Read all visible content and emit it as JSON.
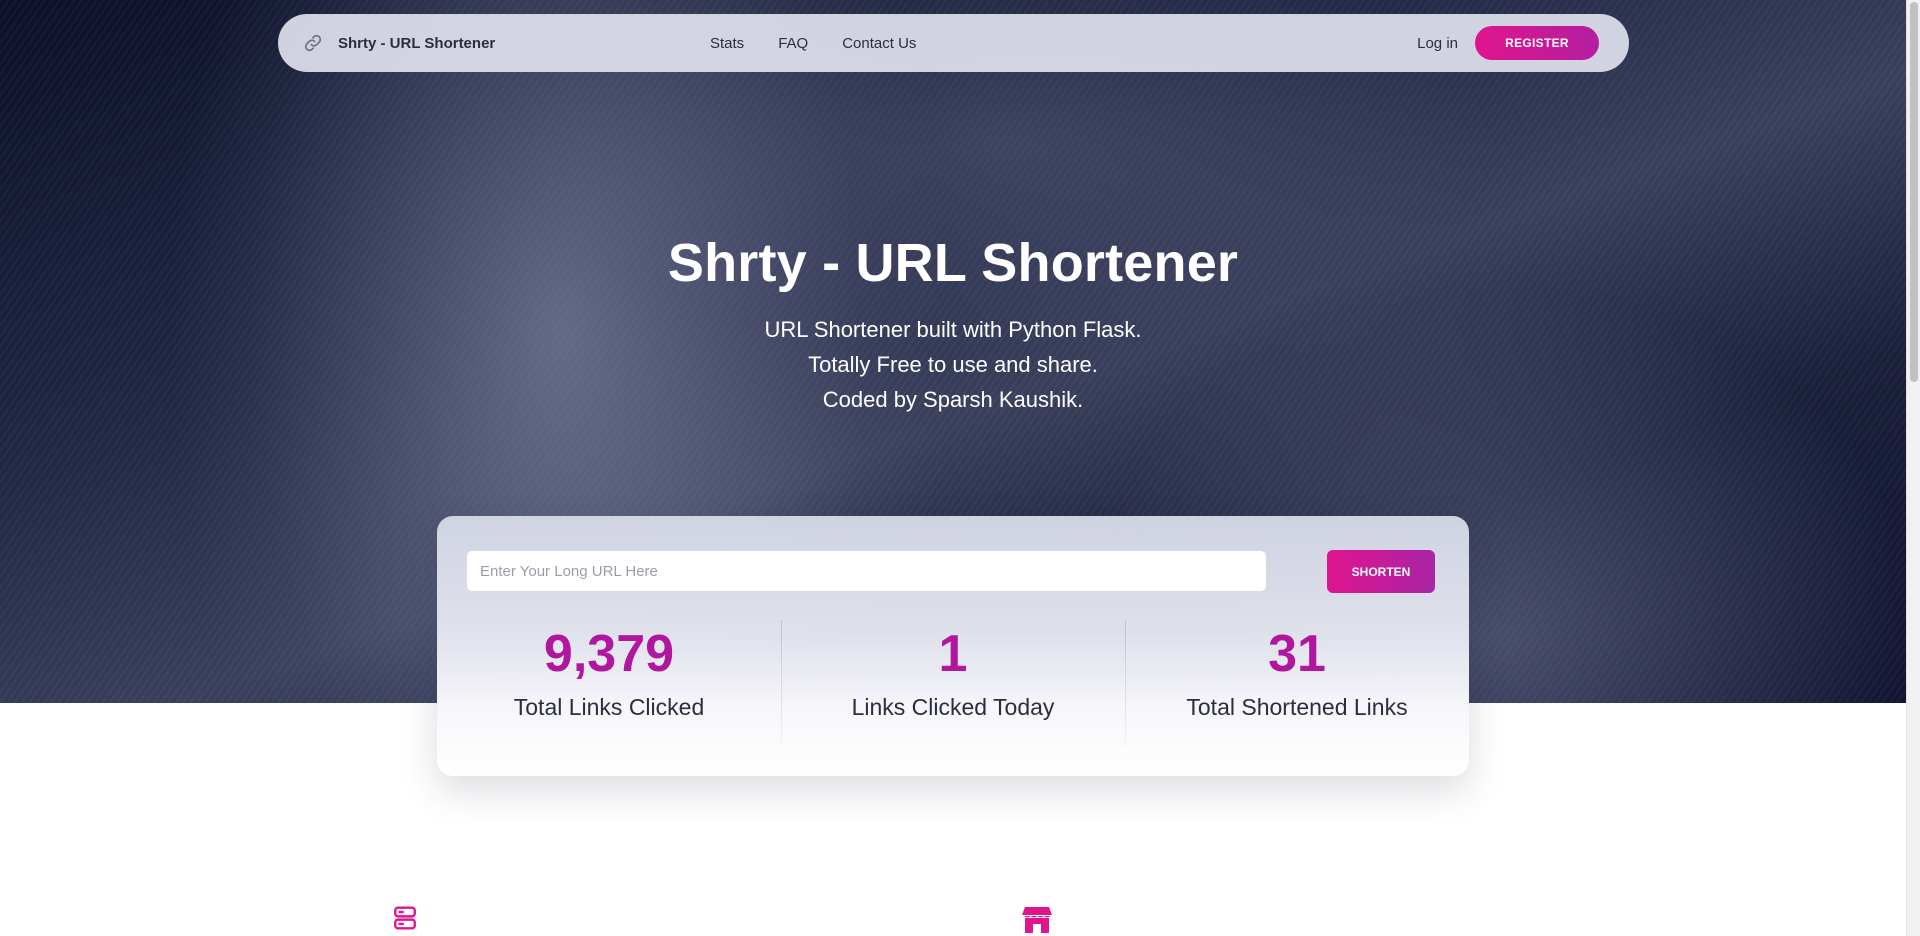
{
  "navbar": {
    "brand": "Shrty - URL Shortener",
    "brand_icon": "link-icon",
    "links": [
      "Stats",
      "FAQ",
      "Contact Us"
    ],
    "login": "Log in",
    "register": "REGISTER"
  },
  "hero": {
    "title": "Shrty - URL Shortener",
    "lines": [
      "URL Shortener built with Python Flask.",
      "Totally Free to use and share.",
      "Coded by Sparsh Kaushik."
    ]
  },
  "shortener": {
    "placeholder": "Enter Your Long URL Here",
    "button": "SHORTEN"
  },
  "stats": [
    {
      "value": "9,379",
      "label": "Total Links Clicked"
    },
    {
      "value": "1",
      "label": "Links Clicked Today"
    },
    {
      "value": "31",
      "label": "Total Shortened Links"
    }
  ],
  "features": {
    "icons": [
      "server-icon",
      "store-icon"
    ]
  },
  "colors": {
    "accent": "#e0148e",
    "accent_secondary": "#b0179e",
    "hero_dark": "#0c1029"
  }
}
